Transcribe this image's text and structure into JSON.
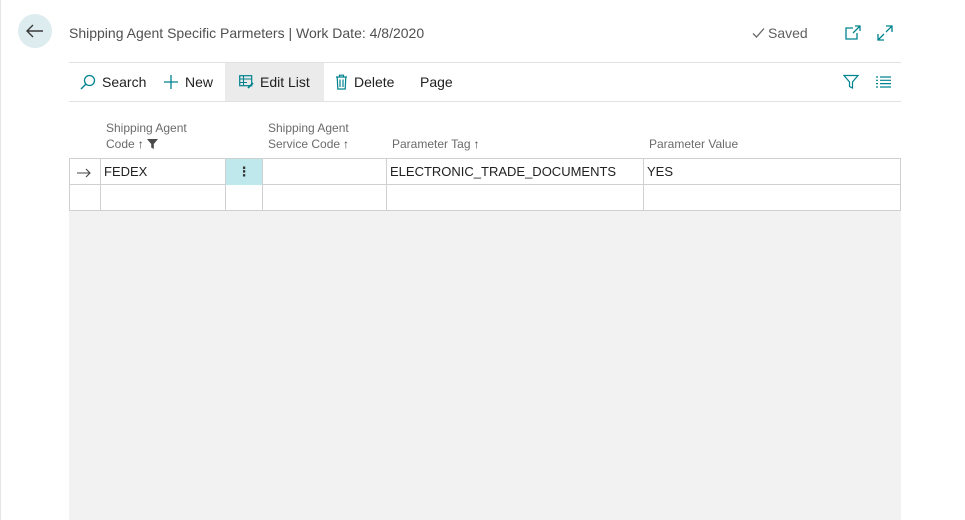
{
  "header": {
    "title": "Shipping Agent Specific Parmeters | Work Date: 4/8/2020",
    "saved_label": "Saved"
  },
  "actions": {
    "search": "Search",
    "new": "New",
    "edit_list": "Edit List",
    "delete": "Delete",
    "page": "Page"
  },
  "columns": {
    "agent_code_line1": "Shipping Agent",
    "agent_code_line2": "Code",
    "service_code_line1": "Shipping Agent",
    "service_code_line2": "Service Code",
    "parameter_tag": "Parameter Tag",
    "parameter_value": "Parameter Value",
    "sort_arrow": "↑"
  },
  "rows": [
    {
      "shipping_agent_code": "FEDEX",
      "actions_menu": "⋮",
      "service_code": "",
      "parameter_tag": "ELECTRONIC_TRADE_DOCUMENTS",
      "parameter_value": "YES"
    },
    {
      "shipping_agent_code": "",
      "actions_menu": "",
      "service_code": "",
      "parameter_tag": "",
      "parameter_value": ""
    }
  ],
  "colors": {
    "accent": "#00838f",
    "selected_cell": "#bfe8ec",
    "active_action": "#ebebeb",
    "back_button_bg": "#dcecef",
    "empty_area": "#f2f2f2"
  },
  "icons": {
    "back": "arrow-left-icon",
    "saved": "check-icon",
    "open_new": "open-in-new-window-icon",
    "expand": "expand-icon",
    "search": "search-icon",
    "new": "plus-icon",
    "edit_list": "edit-list-icon",
    "delete": "trash-icon",
    "filter": "filter-icon",
    "list_view": "list-view-icon",
    "row_indicator": "row-arrow-icon",
    "column_filter": "filter-funnel-icon"
  }
}
